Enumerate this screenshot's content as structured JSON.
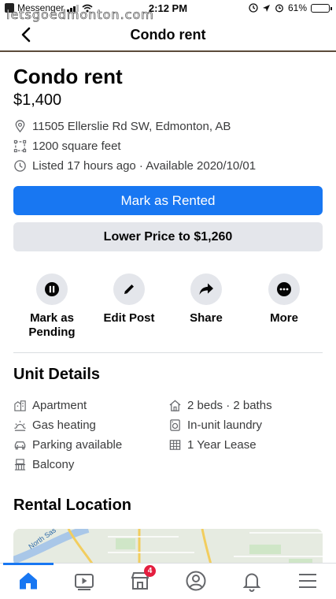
{
  "status_bar": {
    "back_app": "Messenger",
    "time": "2:12 PM",
    "battery": "61%",
    "battery_level": 0.61
  },
  "watermark": "letsgoedmonton.com",
  "header": {
    "title": "Condo  rent",
    "back_icon": "chevron-left-icon"
  },
  "listing": {
    "title": "Condo  rent",
    "price": "$1,400",
    "address": "11505 Ellerslie Rd SW, Edmonton, AB",
    "size": "1200 square feet",
    "listed": "Listed 17 hours ago · Available 2020/10/01"
  },
  "buttons": {
    "primary": "Mark as Rented",
    "secondary": "Lower Price to $1,260"
  },
  "actions": [
    {
      "label": "Mark as\nPending",
      "icon": "pause-icon"
    },
    {
      "label": "Edit Post",
      "icon": "pencil-icon"
    },
    {
      "label": "Share",
      "icon": "share-arrow-icon"
    },
    {
      "label": "More",
      "icon": "more-dots-icon"
    }
  ],
  "unit_details": {
    "title": "Unit Details",
    "left": [
      "Apartment",
      "Gas heating",
      "Parking available",
      "Balcony"
    ],
    "right": [
      "2 beds · 2 baths",
      "In-unit laundry",
      "1 Year Lease"
    ]
  },
  "rental_location": {
    "title": "Rental Location",
    "map_label": "North Sas"
  },
  "tabbar": {
    "notification_badge": "4"
  },
  "colors": {
    "accent": "#1877f2",
    "secondary_bg": "#e4e6eb",
    "badge": "#e41e3f"
  }
}
